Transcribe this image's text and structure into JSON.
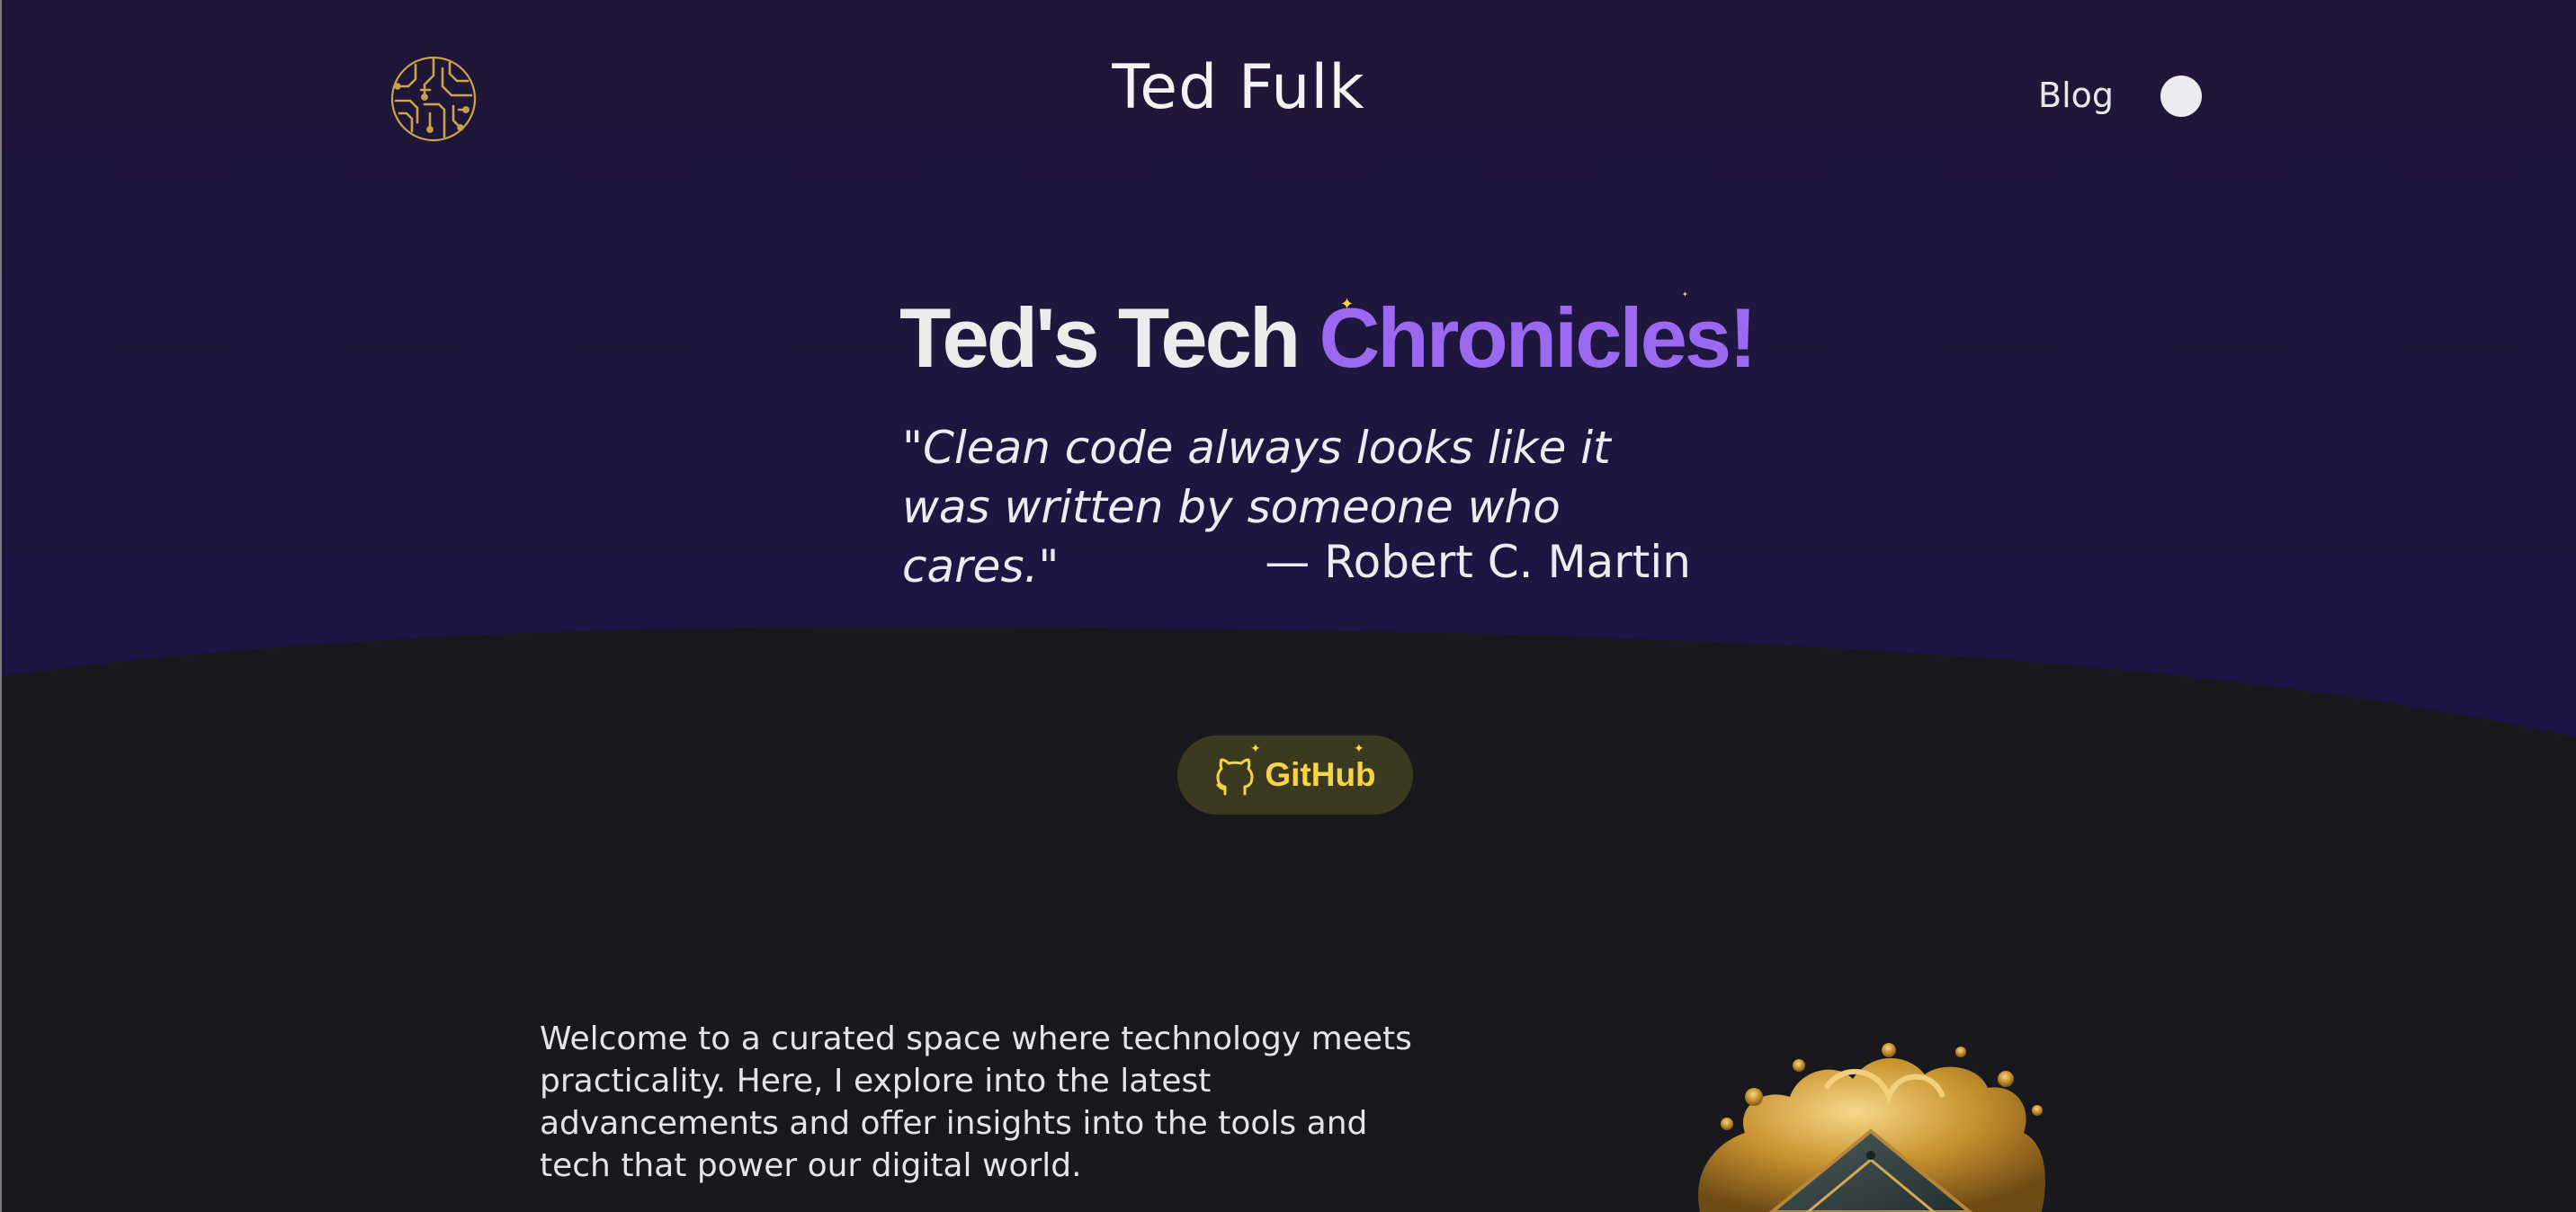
{
  "header": {
    "site_title": "Ted Fulk",
    "nav": {
      "blog_label": "Blog"
    }
  },
  "hero": {
    "heading_part1": "Ted's Tech ",
    "heading_accent": "Chronicles!",
    "quote_text": "\"Clean code always looks like it was written by someone who cares.\"",
    "quote_author": "— Robert C. Martin"
  },
  "github_button": {
    "label": "GitHub"
  },
  "intro": {
    "paragraph": "Welcome to a curated space where technology meets practicality. Here, I explore into the latest advancements and offer insights into the tools and tech that power our digital world."
  },
  "icons": {
    "logo": "circuit-brain-logo",
    "theme_toggle": "circle",
    "github": "github-octocat-icon",
    "sparkle": "sparkle-star"
  },
  "colors": {
    "hero_background": "#1e1538",
    "page_background": "#18181d",
    "accent_purple": "#9b68f0",
    "github_text": "#f4d547",
    "github_button_bg": "#3b3a20",
    "logo_gold": "#c9a44a",
    "sparkle_yellow": "#ffd84a"
  }
}
